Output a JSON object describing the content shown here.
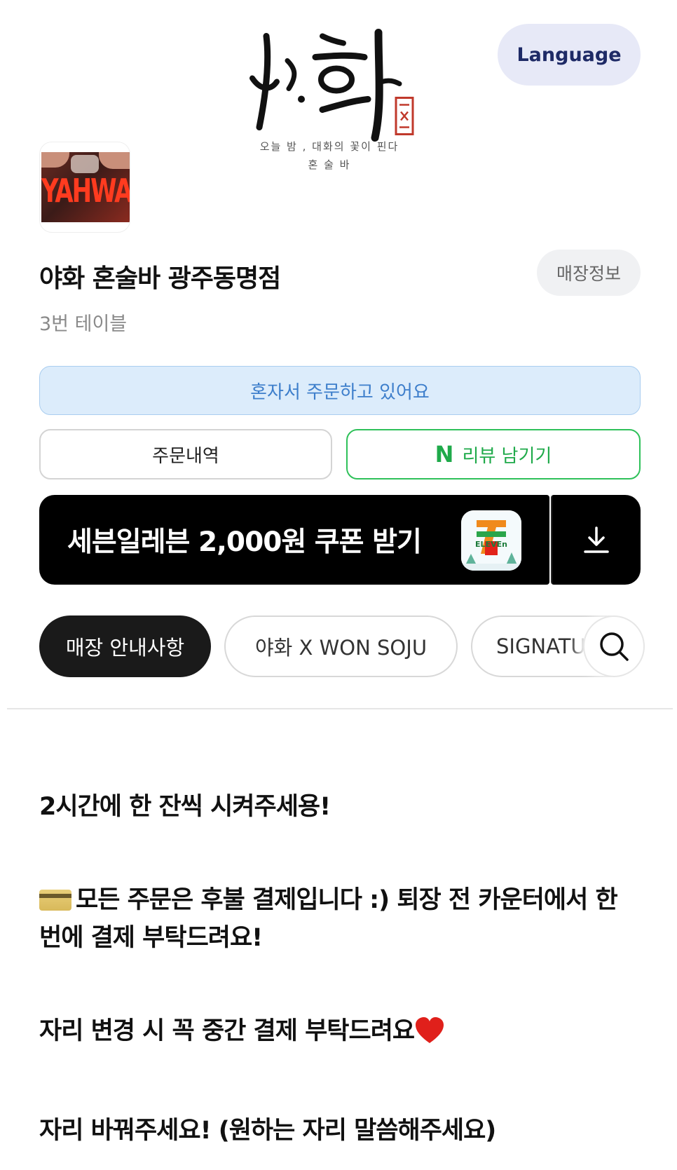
{
  "header": {
    "logo_text": "야화",
    "logo_subtitle_1": "오늘 밤 , 대화의 꽃이 핀다",
    "logo_subtitle_2": "혼 술 바",
    "language_label": "Language"
  },
  "store": {
    "thumbnail_text": "YAHWA",
    "name": "야화 혼술바 광주동명점",
    "info_label": "매장정보",
    "table": "3번 테이블"
  },
  "order_status": "혼자서 주문하고 있어요",
  "actions": {
    "history_label": "주문내역",
    "review_icon": "N",
    "review_label": "리뷰 남기기"
  },
  "coupon": {
    "text": "세븐일레븐 2,000원 쿠폰 받기",
    "logo_text": "ELEVEn",
    "logo_number": "7",
    "download_icon": "download-icon"
  },
  "categories": [
    {
      "label": "매장 안내사항",
      "active": true
    },
    {
      "label": "야화 X WON SOJU",
      "active": false
    },
    {
      "label": "SIGNATURE",
      "active": false
    }
  ],
  "notices": [
    "2시간에 한 잔씩 시켜주세용!",
    "모든 주문은 후불 결제입니다 :) 퇴장 전 카운터에서 한 번에 결제 부탁드려요!",
    "자리 변경 시 꼭 중간 결제 부탁드려요",
    "자리 바꿔주세요! (원하는 자리 말씀해주세요)"
  ],
  "colors": {
    "accent_blue": "#3d7ecb",
    "naver_green": "#1faa4a",
    "language_bg": "#e7e9f7"
  }
}
